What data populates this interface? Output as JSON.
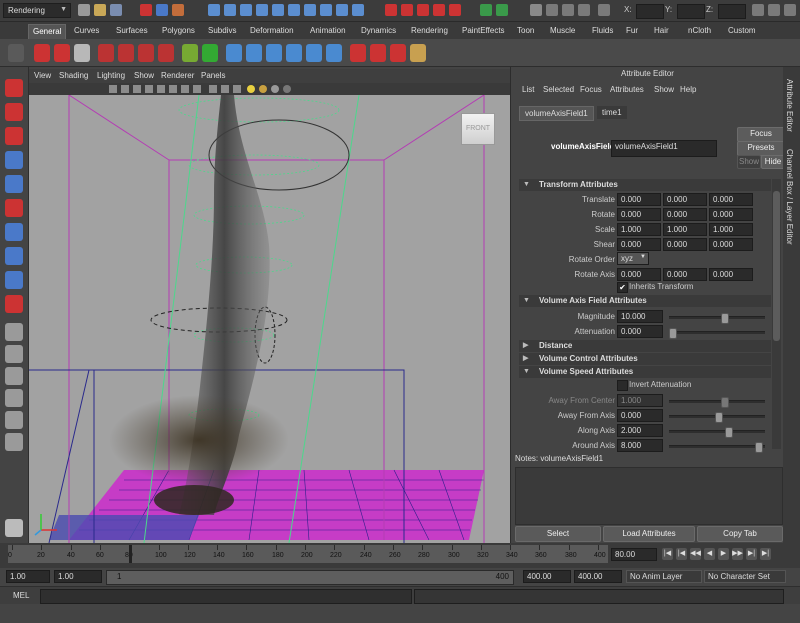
{
  "status_bar": {
    "mode": "Rendering",
    "x_label": "X:",
    "y_label": "Y:",
    "z_label": "Z:"
  },
  "shelf_tabs": [
    "General",
    "Curves",
    "Surfaces",
    "Polygons",
    "Subdivs",
    "Deformation",
    "Animation",
    "Dynamics",
    "Rendering",
    "PaintEffects",
    "Toon",
    "Muscle",
    "Fluids",
    "Fur",
    "Hair",
    "nCloth",
    "Custom"
  ],
  "viewport": {
    "menu": [
      "View",
      "Shading",
      "Lighting",
      "Show",
      "Renderer",
      "Panels"
    ],
    "view_cube_label": "FRONT"
  },
  "attribute_editor": {
    "title": "Attribute Editor",
    "menu": [
      "List",
      "Selected",
      "Focus",
      "Attributes",
      "Show",
      "Help"
    ],
    "tabs": [
      "volumeAxisField1",
      "time1"
    ],
    "node_label": "volumeAxisField:",
    "node_name": "volumeAxisField1",
    "focus_btn": "Focus",
    "presets_btn": "Presets",
    "show_btn": "Show",
    "hide_btn": "Hide",
    "sections": {
      "transform": "Transform Attributes",
      "volume_axis": "Volume Axis Field Attributes",
      "distance": "Distance",
      "volume_control": "Volume Control Attributes",
      "volume_speed": "Volume Speed Attributes"
    },
    "transform": {
      "translate": {
        "label": "Translate",
        "values": [
          "0.000",
          "0.000",
          "0.000"
        ]
      },
      "rotate": {
        "label": "Rotate",
        "values": [
          "0.000",
          "0.000",
          "0.000"
        ]
      },
      "scale": {
        "label": "Scale",
        "values": [
          "1.000",
          "1.000",
          "1.000"
        ]
      },
      "shear": {
        "label": "Shear",
        "values": [
          "0.000",
          "0.000",
          "0.000"
        ]
      },
      "rotate_order": {
        "label": "Rotate Order",
        "value": "xyz"
      },
      "rotate_axis": {
        "label": "Rotate Axis",
        "values": [
          "0.000",
          "0.000",
          "0.000"
        ]
      },
      "inherits": {
        "label": "Inherits Transform",
        "checked": true
      }
    },
    "volume_axis": {
      "magnitude": {
        "label": "Magnitude",
        "value": "10.000",
        "slider": 0.55
      },
      "attenuation": {
        "label": "Attenuation",
        "value": "0.000",
        "slider": 0.0
      }
    },
    "volume_speed": {
      "invert": {
        "label": "Invert Attenuation",
        "checked": false
      },
      "away_center": {
        "label": "Away From Center",
        "value": "1.000",
        "slider": 0.55
      },
      "away_axis": {
        "label": "Away From Axis",
        "value": "0.000",
        "slider": 0.5
      },
      "along_axis": {
        "label": "Along Axis",
        "value": "2.000",
        "slider": 0.6
      },
      "around_axis": {
        "label": "Around Axis",
        "value": "8.000",
        "slider": 0.92
      }
    },
    "notes_label": "Notes:  volumeAxisField1",
    "footer": {
      "select": "Select",
      "load": "Load Attributes",
      "copy": "Copy Tab"
    }
  },
  "side_tabs": {
    "attr": "Attribute Editor",
    "channel": "Channel Box / Layer Editor"
  },
  "timeline": {
    "ticks": [
      "0",
      "20",
      "40",
      "60",
      "80",
      "100",
      "120",
      "140",
      "160",
      "180",
      "200",
      "220",
      "240",
      "260",
      "280",
      "300",
      "320",
      "340",
      "360",
      "380",
      "400"
    ],
    "current_frame": "80.00",
    "current_marker": "80"
  },
  "range": {
    "start": "1.00",
    "playback_start": "1.00",
    "slider_start": "1",
    "slider_end": "400",
    "playback_end": "400.00",
    "end": "400.00",
    "anim_layer": "No Anim Layer",
    "character_set": "No Character Set"
  },
  "command": {
    "label": "MEL"
  }
}
